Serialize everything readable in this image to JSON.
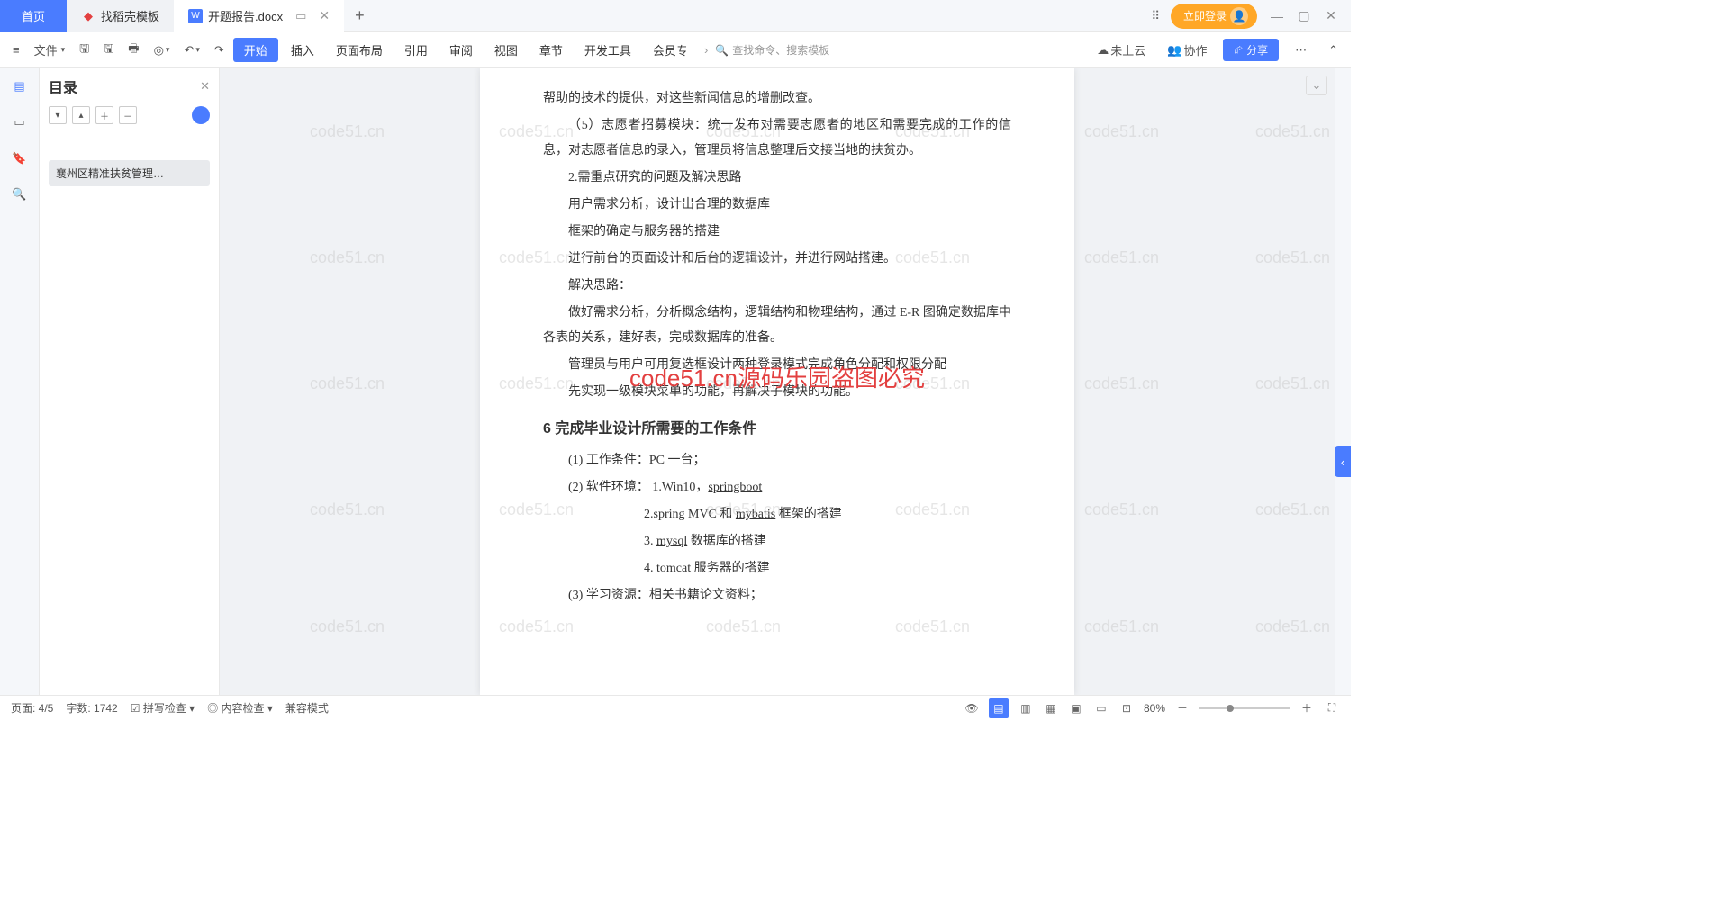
{
  "tabs": {
    "home": "首页",
    "templates": "找稻壳模板",
    "doc": "开题报告.docx"
  },
  "login": "立即登录",
  "file_menu": "文件",
  "ribbon": {
    "start": "开始",
    "insert": "插入",
    "layout": "页面布局",
    "refs": "引用",
    "review": "审阅",
    "view": "视图",
    "section": "章节",
    "dev": "开发工具",
    "member": "会员专"
  },
  "search_placeholder": "查找命令、搜索模板",
  "cloud": "未上云",
  "collab": "协作",
  "share": "分享",
  "outline": {
    "title": "目录",
    "item1": "襄州区精准扶贫管理…"
  },
  "doc": {
    "p1": "帮助的技术的提供，对这些新闻信息的增删改查。",
    "p2": "（5）志愿者招募模块：统一发布对需要志愿者的地区和需要完成的工作的信息，对志愿者信息的录入，管理员将信息整理后交接当地的扶贫办。",
    "p3": "2.需重点研究的问题及解决思路",
    "p4": "用户需求分析，设计出合理的数据库",
    "p5": "框架的确定与服务器的搭建",
    "p6": "进行前台的页面设计和后台的逻辑设计，并进行网站搭建。",
    "p7": "解决思路：",
    "p8": "做好需求分析，分析概念结构，逻辑结构和物理结构，通过 E-R 图确定数据库中各表的关系，建好表，完成数据库的准备。",
    "p9": "管理员与用户可用复选框设计两种登录模式完成角色分配和权限分配",
    "p10": "先实现一级模块菜单的功能，再解决子模块的功能。",
    "h6": "6   完成毕业设计所需要的工作条件",
    "c1": "(1) 工作条件：PC 一台；",
    "c2a": "(2) 软件环境：  1.Win10，",
    "c2b": "springboot",
    "c3a": "2.spring MVC 和 ",
    "c3b": "mybatis",
    "c3c": " 框架的搭建",
    "c4a": "3. ",
    "c4b": "mysql",
    "c4c": " 数据库的搭建",
    "c5": "4. tomcat 服务器的搭建",
    "c6": "(3) 学习资源：相关书籍论文资料；"
  },
  "watermark_main": "code51.cn源码乐园盗图必究",
  "watermark_bg": "code51.cn",
  "status": {
    "page": "页面: 4/5",
    "words": "字数: 1742",
    "spell": "拼写检查",
    "content": "内容检查",
    "compat": "兼容模式",
    "zoom": "80%"
  }
}
